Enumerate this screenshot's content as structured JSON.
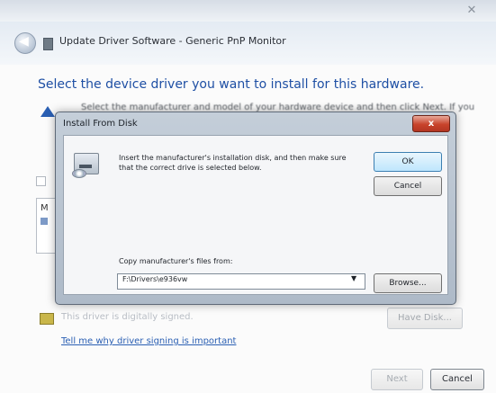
{
  "wizard": {
    "title": "Update Driver Software - Generic PnP Monitor",
    "heading": "Select the device driver you want to install for this hardware.",
    "description": "Select the manufacturer and model of your hardware device and then click Next. If you",
    "description_tail": "ou",
    "list_partial": "M",
    "signed_text": "This driver is digitally signed.",
    "signing_link": "Tell me why driver signing is important",
    "have_disk_label": "Have Disk...",
    "next_label": "Next",
    "cancel_label": "Cancel",
    "close_glyph": "✕"
  },
  "dialog": {
    "title": "Install From Disk",
    "close_glyph": "x",
    "instruction": "Insert the manufacturer's installation disk, and then make sure that the correct drive is selected below.",
    "ok_label": "OK",
    "cancel_label": "Cancel",
    "copy_label": "Copy manufacturer's files from:",
    "path_value": "F:\\Drivers\\e936vw",
    "browse_label": "Browse..."
  },
  "colors": {
    "heading_blue": "#1e4fa4",
    "close_red": "#c8432b",
    "link_blue": "#2a5fb3"
  }
}
